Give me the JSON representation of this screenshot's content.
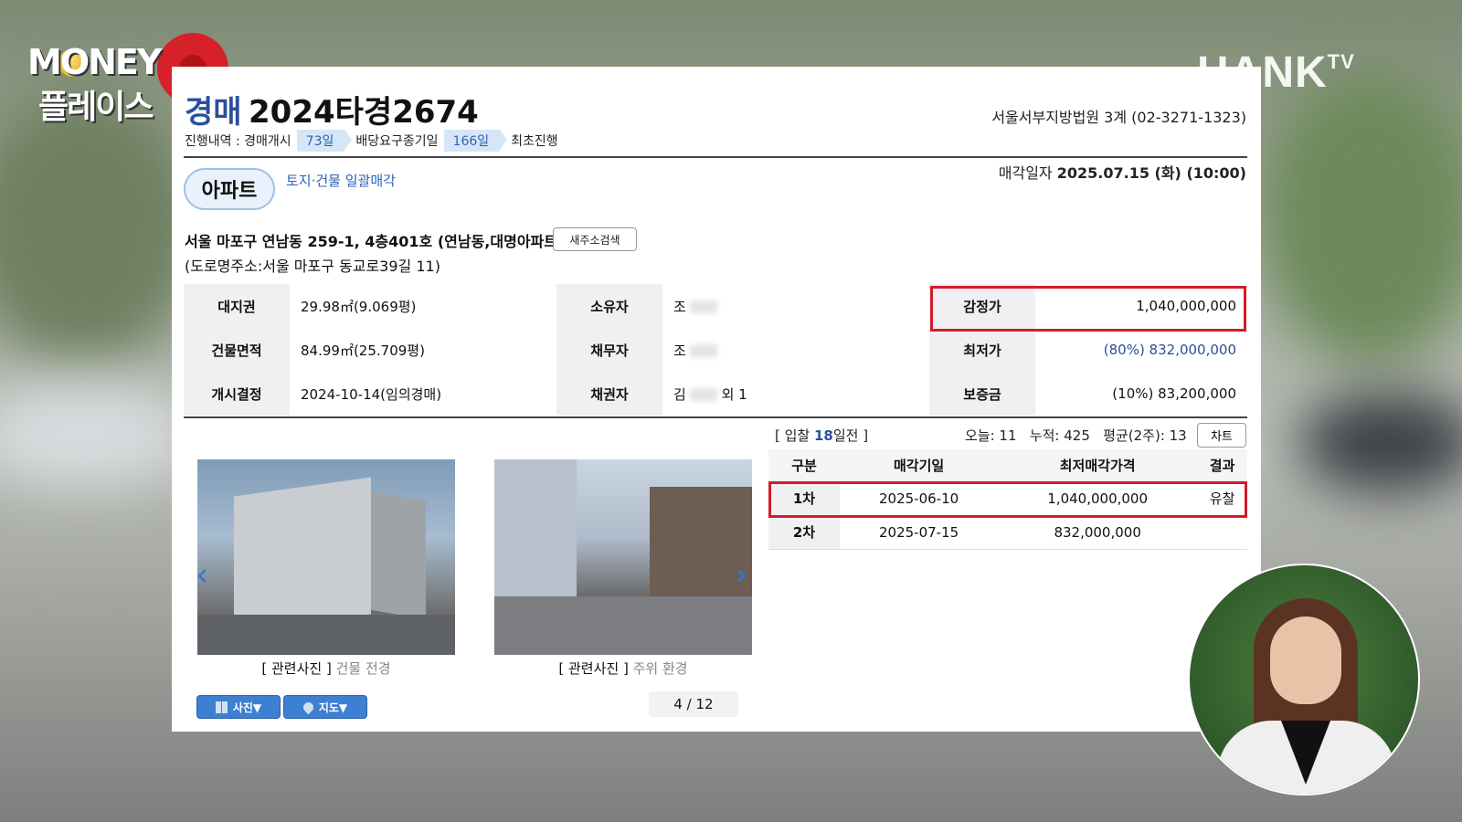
{
  "brand": {
    "logo_line1": "MONEY",
    "logo_line2": "플레이스",
    "channel": "HANK",
    "channel_sup": "TV"
  },
  "header": {
    "kind": "경매",
    "case_no": "2024타경2674",
    "court": "서울서부지방법원 3계 (02-3271-1323)",
    "progress_label": "진행내역 : 경매개시",
    "progress_days1": "73일",
    "progress_step2": "배당요구종기일",
    "progress_days2": "166일",
    "progress_step3": "최초진행",
    "sale_date_label": "매각일자",
    "sale_date_value": "2025.07.15 (화) (10:00)"
  },
  "property": {
    "type_badge": "아파트",
    "sale_method": "토지·건물 일괄매각",
    "address": "서울 마포구 연남동 259-1, 4층401호 (연남동,대명아파트)",
    "new_addr_button": "새주소검색",
    "road_address": "(도로명주소:서울 마포구 동교로39길 11)"
  },
  "info": {
    "land_k": "대지권",
    "land_v": "29.98㎡(9.069평)",
    "owner_k": "소유자",
    "owner_v": "조",
    "appraisal_k": "감정가",
    "appraisal_v": "1,040,000,000",
    "building_k": "건물면적",
    "building_v": "84.99㎡(25.709평)",
    "debtor_k": "채무자",
    "debtor_v": "조",
    "min_k": "최저가",
    "min_v": "(80%) 832,000,000",
    "start_k": "개시결정",
    "start_v": "2024-10-14(임의경매)",
    "creditor_k": "채권자",
    "creditor_v_prefix": "김",
    "creditor_v_suffix": "외 1",
    "deposit_k": "보증금",
    "deposit_v": "(10%) 83,200,000"
  },
  "bidding": {
    "days_prefix": "[ 입찰 ",
    "days_num": "18",
    "days_suffix": "일전 ]",
    "stats": "오늘: 11   누적: 425   평균(2주): 13",
    "chart_button": "차트",
    "columns": [
      "구분",
      "매각기일",
      "최저매각가격",
      "결과"
    ],
    "rows": [
      {
        "round": "1차",
        "date": "2025-06-10",
        "price": "1,040,000,000",
        "result": "유찰"
      },
      {
        "round": "2차",
        "date": "2025-07-15",
        "price": "832,000,000",
        "result": ""
      }
    ]
  },
  "photos": {
    "caption1_a": "[ 관련사진 ]",
    "caption1_b": "건물 전경",
    "caption2_a": "[ 관련사진 ]",
    "caption2_b": "주위 환경",
    "btn_photo": "사진▼",
    "btn_map": "지도▼",
    "pager": "4 / 12"
  },
  "colors": {
    "accent_blue": "#2b4f9c",
    "highlight_red": "#d21c2a",
    "badge_border": "#9cc3ea"
  }
}
